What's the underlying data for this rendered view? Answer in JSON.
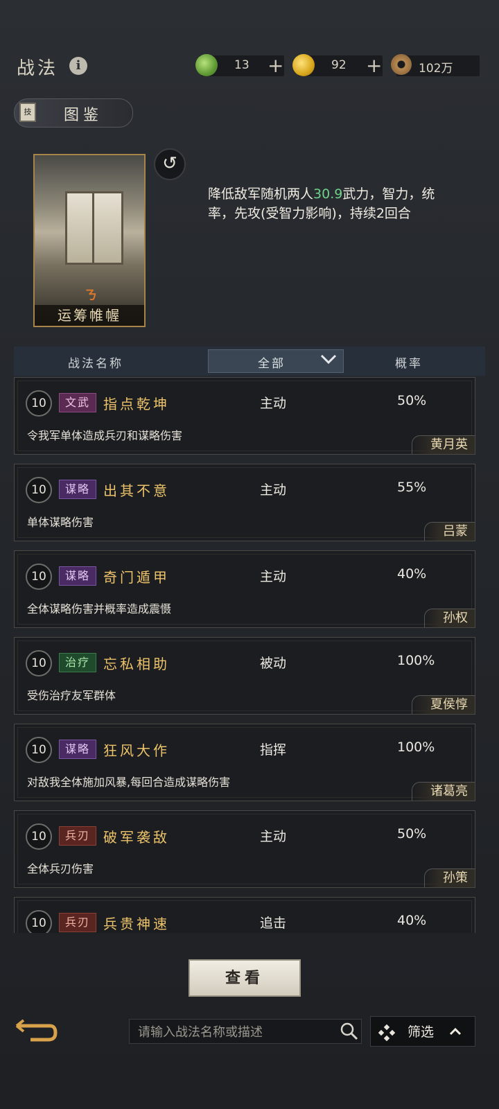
{
  "header": {
    "title": "战法",
    "info_icon": "info-icon",
    "resources": [
      {
        "name": "jade",
        "icon": "jade-icon",
        "value": "13"
      },
      {
        "name": "gold",
        "icon": "gold-coin-icon",
        "value": "92"
      },
      {
        "name": "copper",
        "icon": "copper-coin-icon",
        "value": "102万"
      }
    ]
  },
  "tujian": {
    "label": "图鉴",
    "icon_char": "技"
  },
  "skill_card": {
    "name": "运筹帷幄",
    "desc_prefix": "降低敌军随机两人",
    "desc_value": "30.9",
    "desc_suffix": "武力，智力，统率，先攻(受智力影响)，持续2回合"
  },
  "list_header": {
    "name_col": "战法名称",
    "filter_value": "全部",
    "rate_col": "概率"
  },
  "skills": [
    {
      "level": "10",
      "tag": "文武",
      "tag_type": "wenwu",
      "name": "指点乾坤",
      "type": "主动",
      "rate": "50%",
      "desc": "令我军单体造成兵刃和谋略伤害",
      "hero": "黄月英"
    },
    {
      "level": "10",
      "tag": "谋略",
      "tag_type": "moulue",
      "name": "出其不意",
      "type": "主动",
      "rate": "55%",
      "desc": "单体谋略伤害",
      "hero": "吕蒙"
    },
    {
      "level": "10",
      "tag": "谋略",
      "tag_type": "moulue",
      "name": "奇门遁甲",
      "type": "主动",
      "rate": "40%",
      "desc": "全体谋略伤害并概率造成震慑",
      "hero": "孙权"
    },
    {
      "level": "10",
      "tag": "治疗",
      "tag_type": "zhiliao",
      "name": "忘私相助",
      "type": "被动",
      "rate": "100%",
      "desc": "受伤治疗友军群体",
      "hero": "夏侯惇"
    },
    {
      "level": "10",
      "tag": "谋略",
      "tag_type": "moulue",
      "name": "狂风大作",
      "type": "指挥",
      "rate": "100%",
      "desc": "对敌我全体施加风暴,每回合造成谋略伤害",
      "hero": "诸葛亮"
    },
    {
      "level": "10",
      "tag": "兵刃",
      "tag_type": "bingren",
      "name": "破军袭敌",
      "type": "主动",
      "rate": "50%",
      "desc": "全体兵刃伤害",
      "hero": "孙策"
    },
    {
      "level": "10",
      "tag": "兵刃",
      "tag_type": "bingren",
      "name": "兵贵神速",
      "type": "追击",
      "rate": "40%",
      "desc": "",
      "hero": ""
    }
  ],
  "bottom": {
    "view_label": "查看",
    "search_placeholder": "请输入战法名称或描述",
    "search_value": "",
    "filter_label": "筛选"
  }
}
